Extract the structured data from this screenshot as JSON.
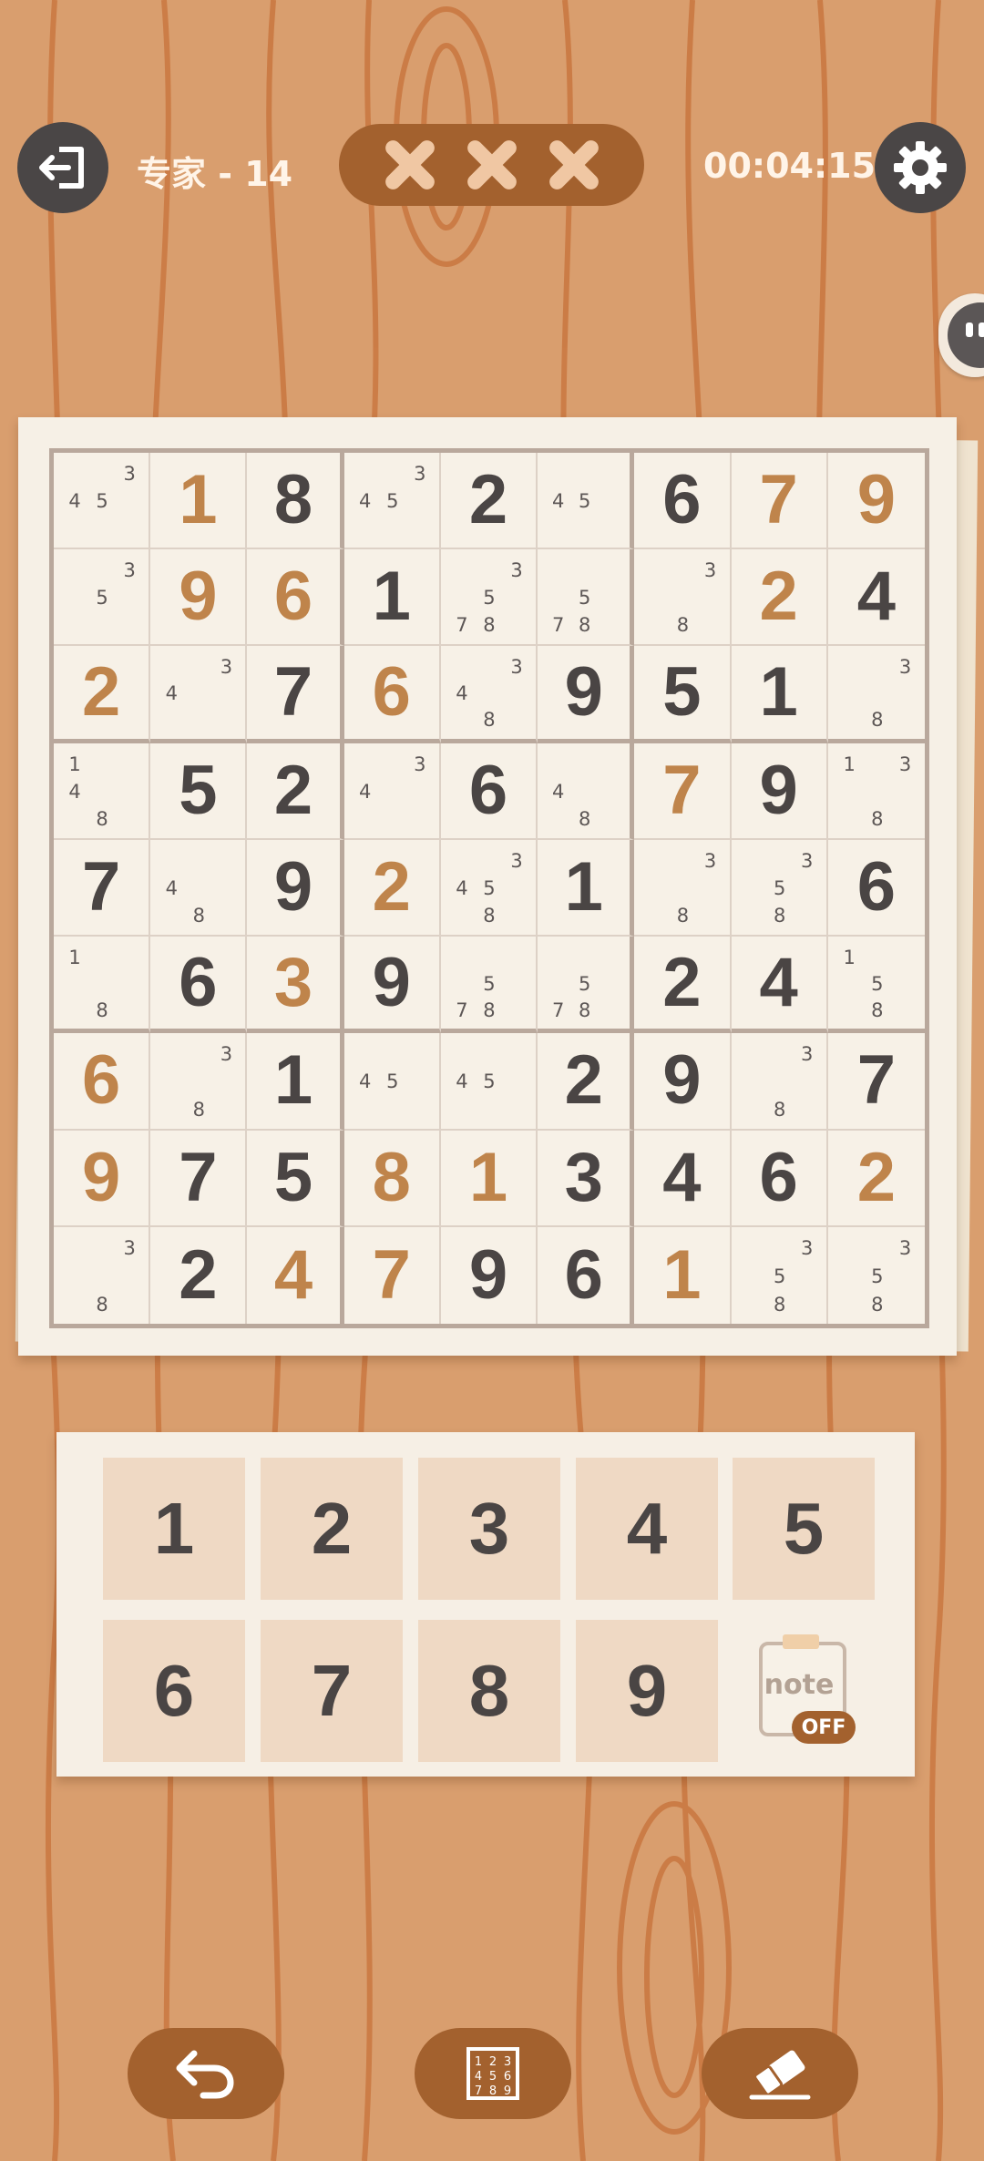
{
  "header": {
    "level": "专家 - 14",
    "timer": "00:04:15",
    "mistakes_used": 3,
    "mistakes_max": 3
  },
  "icons": {
    "exit": "exit-door-icon",
    "settings": "gear-icon",
    "mistake": "x-mark-icon",
    "note": "note-clipboard-icon",
    "undo": "undo-arrow-icon",
    "hint": "number-grid-icon",
    "erase": "eraser-icon"
  },
  "colors": {
    "given_digit": "#4a4544",
    "user_digit": "#bf844b",
    "button_dark": "#4a4646",
    "button_brown": "#a3612e"
  },
  "board": {
    "cells": [
      [
        {
          "notes": "345"
        },
        {
          "v": "1",
          "u": 1
        },
        {
          "v": "8"
        },
        {
          "notes": "345"
        },
        {
          "v": "2"
        },
        {
          "notes": "45"
        },
        {
          "v": "6"
        },
        {
          "v": "7",
          "u": 1
        },
        {
          "v": "9",
          "u": 1
        }
      ],
      [
        {
          "notes": "35"
        },
        {
          "v": "9",
          "u": 1
        },
        {
          "v": "6",
          "u": 1
        },
        {
          "v": "1"
        },
        {
          "notes": "3578"
        },
        {
          "notes": "578"
        },
        {
          "notes": "38"
        },
        {
          "v": "2",
          "u": 1
        },
        {
          "v": "4"
        }
      ],
      [
        {
          "v": "2",
          "u": 1
        },
        {
          "notes": "34"
        },
        {
          "v": "7"
        },
        {
          "v": "6",
          "u": 1
        },
        {
          "notes": "348"
        },
        {
          "v": "9"
        },
        {
          "v": "5"
        },
        {
          "v": "1"
        },
        {
          "notes": "38"
        }
      ],
      [
        {
          "notes": "148"
        },
        {
          "v": "5"
        },
        {
          "v": "2"
        },
        {
          "notes": "34"
        },
        {
          "v": "6"
        },
        {
          "notes": "48"
        },
        {
          "v": "7",
          "u": 1
        },
        {
          "v": "9"
        },
        {
          "notes": "138"
        }
      ],
      [
        {
          "v": "7"
        },
        {
          "notes": "48"
        },
        {
          "v": "9"
        },
        {
          "v": "2",
          "u": 1
        },
        {
          "notes": "3458"
        },
        {
          "v": "1"
        },
        {
          "notes": "38"
        },
        {
          "notes": "358"
        },
        {
          "v": "6"
        }
      ],
      [
        {
          "notes": "18"
        },
        {
          "v": "6"
        },
        {
          "v": "3",
          "u": 1
        },
        {
          "v": "9"
        },
        {
          "notes": "578"
        },
        {
          "notes": "578"
        },
        {
          "v": "2"
        },
        {
          "v": "4"
        },
        {
          "notes": "158"
        }
      ],
      [
        {
          "v": "6",
          "u": 1
        },
        {
          "notes": "38"
        },
        {
          "v": "1"
        },
        {
          "notes": "45"
        },
        {
          "notes": "45"
        },
        {
          "v": "2"
        },
        {
          "v": "9"
        },
        {
          "notes": "38"
        },
        {
          "v": "7"
        }
      ],
      [
        {
          "v": "9",
          "u": 1
        },
        {
          "v": "7"
        },
        {
          "v": "5"
        },
        {
          "v": "8",
          "u": 1
        },
        {
          "v": "1",
          "u": 1
        },
        {
          "v": "3"
        },
        {
          "v": "4"
        },
        {
          "v": "6"
        },
        {
          "v": "2",
          "u": 1
        }
      ],
      [
        {
          "notes": "38"
        },
        {
          "v": "2"
        },
        {
          "v": "4",
          "u": 1
        },
        {
          "v": "7",
          "u": 1
        },
        {
          "v": "9"
        },
        {
          "v": "6"
        },
        {
          "v": "1",
          "u": 1
        },
        {
          "notes": "358"
        },
        {
          "notes": "358"
        }
      ]
    ]
  },
  "numpad": {
    "keys": [
      "1",
      "2",
      "3",
      "4",
      "5",
      "6",
      "7",
      "8",
      "9"
    ],
    "note_label": "note",
    "note_state": "OFF"
  }
}
